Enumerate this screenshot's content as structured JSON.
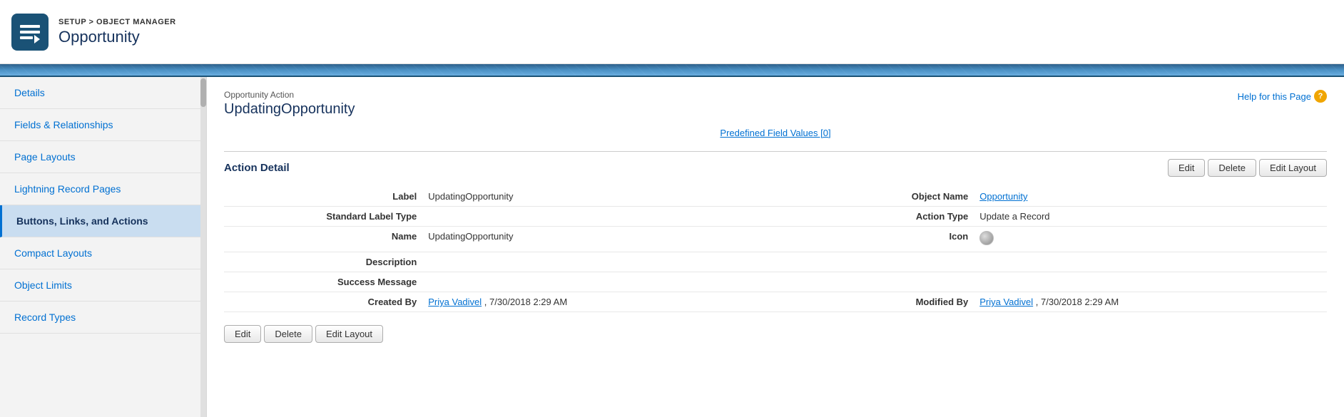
{
  "header": {
    "breadcrumb_setup": "SETUP",
    "breadcrumb_separator": " > ",
    "breadcrumb_object_manager": "OBJECT MANAGER",
    "title": "Opportunity"
  },
  "sidebar": {
    "items": [
      {
        "id": "details",
        "label": "Details"
      },
      {
        "id": "fields-relationships",
        "label": "Fields & Relationships"
      },
      {
        "id": "page-layouts",
        "label": "Page Layouts"
      },
      {
        "id": "lightning-record-pages",
        "label": "Lightning Record Pages"
      },
      {
        "id": "buttons-links-actions",
        "label": "Buttons, Links, and Actions",
        "active": true
      },
      {
        "id": "compact-layouts",
        "label": "Compact Layouts"
      },
      {
        "id": "object-limits",
        "label": "Object Limits"
      },
      {
        "id": "record-types",
        "label": "Record Types"
      }
    ]
  },
  "content": {
    "help_link_label": "Help for this Page",
    "action_label": "Opportunity Action",
    "action_title": "UpdatingOpportunity",
    "predefined_link": "Predefined Field Values [0]",
    "section_title": "Action Detail",
    "buttons": {
      "edit": "Edit",
      "delete": "Delete",
      "edit_layout": "Edit Layout"
    },
    "fields": {
      "label_key": "Label",
      "label_value": "UpdatingOpportunity",
      "object_name_key": "Object Name",
      "object_name_value": "Opportunity",
      "standard_label_type_key": "Standard Label Type",
      "standard_label_type_value": "",
      "action_type_key": "Action Type",
      "action_type_value": "Update a Record",
      "name_key": "Name",
      "name_value": "UpdatingOpportunity",
      "icon_key": "Icon",
      "description_key": "Description",
      "description_value": "",
      "success_message_key": "Success Message",
      "success_message_value": "",
      "created_by_key": "Created By",
      "created_by_value": "Priya Vadivel",
      "created_by_date": ", 7/30/2018 2:29 AM",
      "modified_by_key": "Modified By",
      "modified_by_value": "Priya Vadivel",
      "modified_by_date": ", 7/30/2018 2:29 AM"
    }
  }
}
